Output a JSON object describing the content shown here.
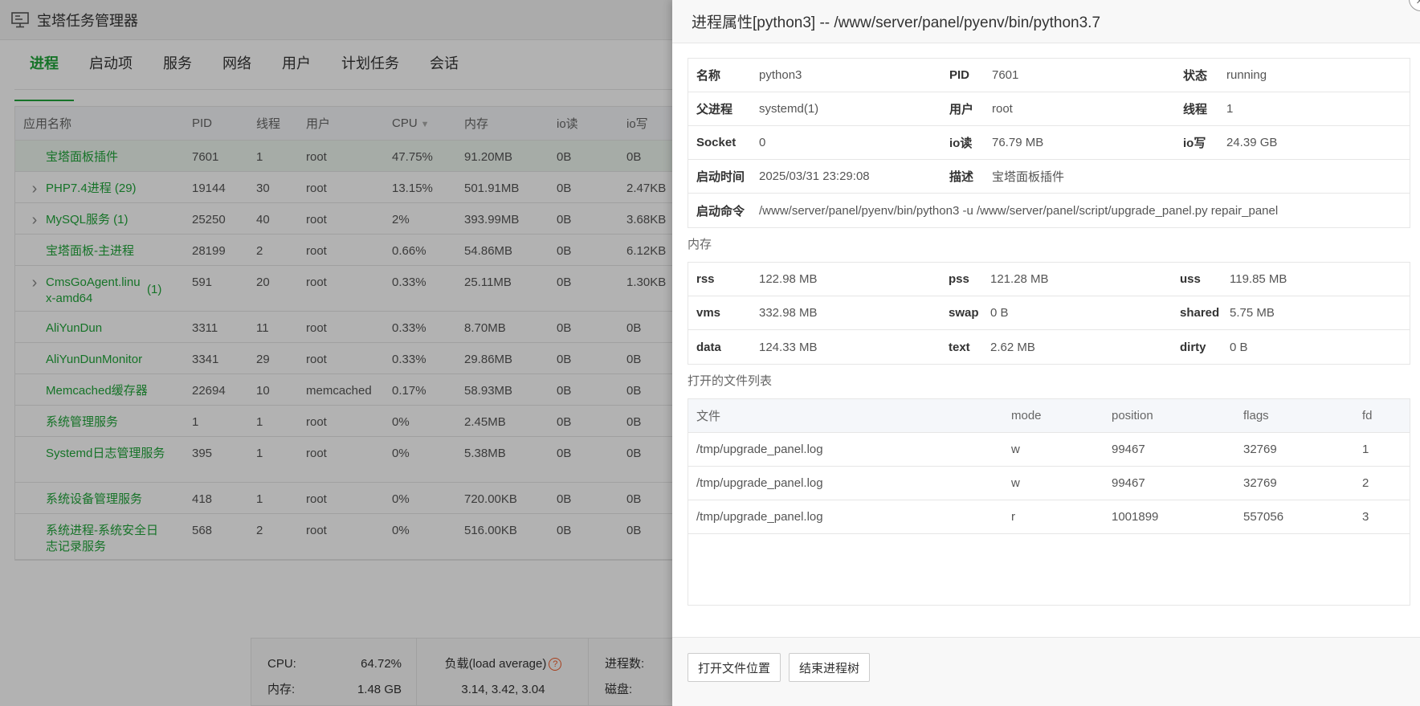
{
  "app": {
    "title": "宝塔任务管理器"
  },
  "tabs": [
    "进程",
    "启动项",
    "服务",
    "网络",
    "用户",
    "计划任务",
    "会话"
  ],
  "process_table": {
    "headers": [
      "应用名称",
      "PID",
      "线程",
      "用户",
      "CPU",
      "内存",
      "io读",
      "io写"
    ],
    "rows": [
      {
        "expandable": false,
        "name": "宝塔面板插件",
        "count": "",
        "pid": "7601",
        "threads": "1",
        "user": "root",
        "cpu": "47.75%",
        "mem": "91.20MB",
        "ior": "0B",
        "iow": "0B"
      },
      {
        "expandable": true,
        "name": "PHP7.4进程 (29)",
        "count": "",
        "pid": "19144",
        "threads": "30",
        "user": "root",
        "cpu": "13.15%",
        "mem": "501.91MB",
        "ior": "0B",
        "iow": "2.47KB"
      },
      {
        "expandable": true,
        "name": "MySQL服务 (1)",
        "count": "",
        "pid": "25250",
        "threads": "40",
        "user": "root",
        "cpu": "2%",
        "mem": "393.99MB",
        "ior": "0B",
        "iow": "3.68KB"
      },
      {
        "expandable": false,
        "name": "宝塔面板-主进程",
        "count": "",
        "pid": "28199",
        "threads": "2",
        "user": "root",
        "cpu": "0.66%",
        "mem": "54.86MB",
        "ior": "0B",
        "iow": "6.12KB"
      },
      {
        "expandable": true,
        "name": "CmsGoAgent.linux-amd64",
        "count": "(1)",
        "pid": "591",
        "threads": "20",
        "user": "root",
        "cpu": "0.33%",
        "mem": "25.11MB",
        "ior": "0B",
        "iow": "1.30KB"
      },
      {
        "expandable": false,
        "name": "AliYunDun",
        "count": "",
        "pid": "3311",
        "threads": "11",
        "user": "root",
        "cpu": "0.33%",
        "mem": "8.70MB",
        "ior": "0B",
        "iow": "0B"
      },
      {
        "expandable": false,
        "name": "AliYunDunMonitor",
        "count": "",
        "pid": "3341",
        "threads": "29",
        "user": "root",
        "cpu": "0.33%",
        "mem": "29.86MB",
        "ior": "0B",
        "iow": "0B"
      },
      {
        "expandable": false,
        "name": "Memcached缓存器",
        "count": "",
        "pid": "22694",
        "threads": "10",
        "user": "memcached",
        "cpu": "0.17%",
        "mem": "58.93MB",
        "ior": "0B",
        "iow": "0B"
      },
      {
        "expandable": false,
        "name": "系统管理服务",
        "count": "",
        "pid": "1",
        "threads": "1",
        "user": "root",
        "cpu": "0%",
        "mem": "2.45MB",
        "ior": "0B",
        "iow": "0B"
      },
      {
        "expandable": false,
        "name": "Systemd日志管理服务",
        "count": "",
        "pid": "395",
        "threads": "1",
        "user": "root",
        "cpu": "0%",
        "mem": "5.38MB",
        "ior": "0B",
        "iow": "0B"
      },
      {
        "expandable": false,
        "name": "系统设备管理服务",
        "count": "",
        "pid": "418",
        "threads": "1",
        "user": "root",
        "cpu": "0%",
        "mem": "720.00KB",
        "ior": "0B",
        "iow": "0B"
      },
      {
        "expandable": false,
        "name": "系统进程-系统安全日志记录服务",
        "count": "",
        "pid": "568",
        "threads": "2",
        "user": "root",
        "cpu": "0%",
        "mem": "516.00KB",
        "ior": "0B",
        "iow": "0B"
      }
    ]
  },
  "summary": {
    "cpu_label": "CPU:",
    "cpu_value": "64.72%",
    "mem_label": "内存:",
    "mem_value": "1.48 GB",
    "load_label": "负载(load average)",
    "load_value": "3.14, 3.42, 3.04",
    "proc_label": "进程数:",
    "disk_label": "磁盘:"
  },
  "modal": {
    "title": "进程属性[python3] -- /www/server/panel/pyenv/bin/python3.7",
    "info": {
      "name_k": "名称",
      "name_v": "python3",
      "pid_k": "PID",
      "pid_v": "7601",
      "status_k": "状态",
      "status_v": "running",
      "ppid_k": "父进程",
      "ppid_v": "systemd(1)",
      "user_k": "用户",
      "user_v": "root",
      "threads_k": "线程",
      "threads_v": "1",
      "socket_k": "Socket",
      "socket_v": "0",
      "ior_k": "io读",
      "ior_v": "76.79 MB",
      "iow_k": "io写",
      "iow_v": "24.39 GB",
      "start_k": "启动时间",
      "start_v": "2025/03/31 23:29:08",
      "desc_k": "描述",
      "desc_v": "宝塔面板插件",
      "cmd_k": "启动命令",
      "cmd_v": "/www/server/panel/pyenv/bin/python3 -u /www/server/panel/script/upgrade_panel.py repair_panel"
    },
    "memory_title": "内存",
    "memory": {
      "rss_k": "rss",
      "rss_v": "122.98 MB",
      "pss_k": "pss",
      "pss_v": "121.28 MB",
      "uss_k": "uss",
      "uss_v": "119.85 MB",
      "vms_k": "vms",
      "vms_v": "332.98 MB",
      "swap_k": "swap",
      "swap_v": "0 B",
      "shared_k": "shared",
      "shared_v": "5.75 MB",
      "data_k": "data",
      "data_v": "124.33 MB",
      "text_k": "text",
      "text_v": "2.62 MB",
      "dirty_k": "dirty",
      "dirty_v": "0 B"
    },
    "files_title": "打开的文件列表",
    "files_headers": [
      "文件",
      "mode",
      "position",
      "flags",
      "fd"
    ],
    "files": [
      [
        "/tmp/upgrade_panel.log",
        "w",
        "99467",
        "32769",
        "1"
      ],
      [
        "/tmp/upgrade_panel.log",
        "w",
        "99467",
        "32769",
        "2"
      ],
      [
        "/tmp/upgrade_panel.log",
        "r",
        "1001899",
        "557056",
        "3"
      ]
    ],
    "buttons": {
      "open_location": "打开文件位置",
      "kill_tree": "结束进程树"
    }
  }
}
